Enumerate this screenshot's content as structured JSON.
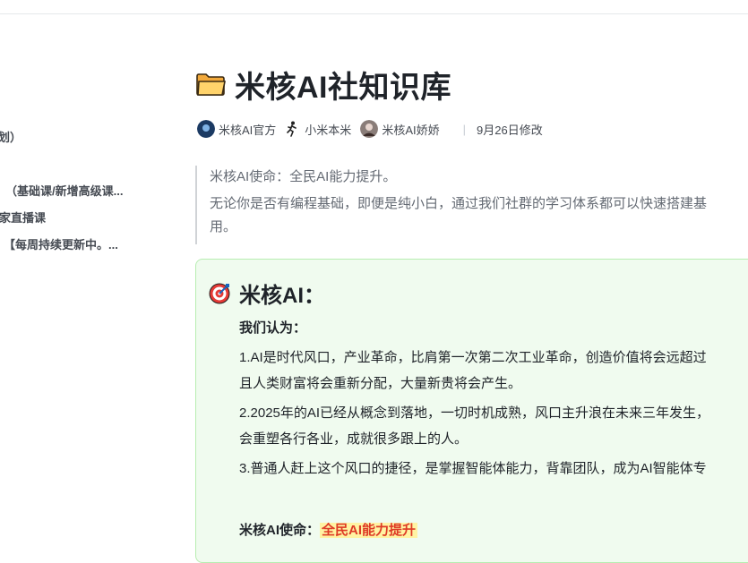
{
  "outline": {
    "items": [
      "划）",
      "（基础课/新增高级课...",
      "家直播课",
      "【每周持续更新中。..."
    ]
  },
  "doc": {
    "title": "米核AI社知识库",
    "authors": [
      "米核AI官方",
      "小米本米",
      "米核AI娇娇"
    ],
    "modified": "9月26日修改",
    "quote": {
      "line1": "米核AI使命：全民AI能力提升。",
      "line2": "无论你是否有编程基础，即便是纯小白，通过我们社群的学习体系都可以快速搭建基",
      "line3": "用。"
    },
    "callout": {
      "title": "米核AI：",
      "subtitle": "我们认为：",
      "points": [
        "1.AI是时代风口，产业革命，比肩第一次第二次工业革命，创造价值将会远超过",
        "且人类财富将会重新分配，大量新贵将会产生。",
        "2.2025年的AI已经从概念到落地，一切时机成熟，风口主升浪在未来三年发生，",
        "会重塑各行各业，成就很多跟上的人。",
        "3.普通人赶上这个风口的捷径，是掌握智能体能力，背靠团队，成为AI智能体专"
      ],
      "mission_label": "米核AI使命：",
      "mission_value": "全民AI能力提升"
    }
  },
  "colors": {
    "callout_bg": "#f0fbef",
    "callout_border": "#b7edb1",
    "highlight_bg": "#fff3a3",
    "highlight_text": "#de3a25"
  }
}
